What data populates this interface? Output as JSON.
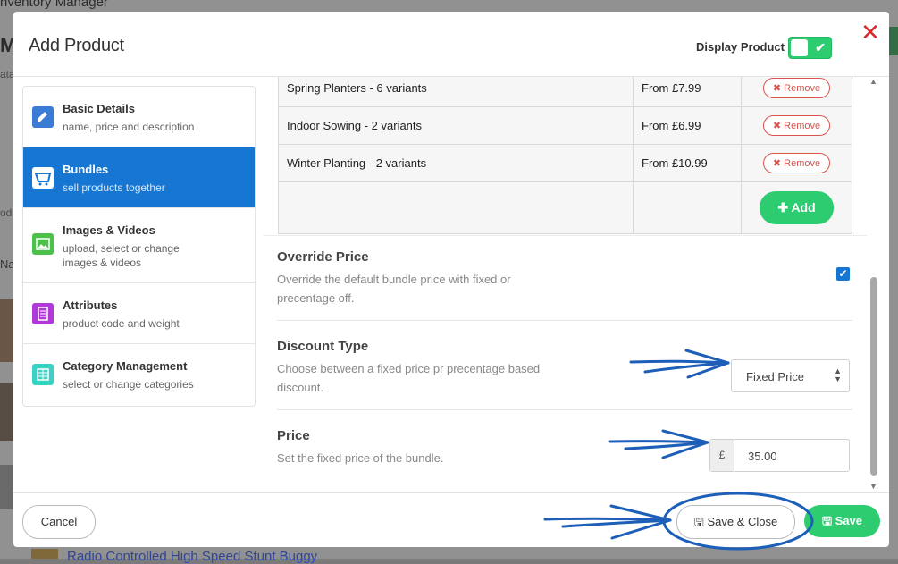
{
  "background": {
    "app_title": "nventory Manager",
    "page_initial": "M",
    "col_frag_1": "ata",
    "col_frag_2": "od",
    "col_frag_3": "Na",
    "footer_product": "Radio Controlled High Speed Stunt Buggy"
  },
  "modal": {
    "title": "Add Product",
    "display_product_label": "Display Product",
    "display_product_on": true
  },
  "sidebar": {
    "items": [
      {
        "title": "Basic Details",
        "subtitle": "name, price and description",
        "icon": "pencil-icon",
        "color": "#3a7bd5"
      },
      {
        "title": "Bundles",
        "subtitle": "sell products together",
        "icon": "basket-icon",
        "color": "#1676d2",
        "active": true
      },
      {
        "title": "Images & Videos",
        "subtitle": "upload, select or change images & videos",
        "icon": "image-icon",
        "color": "#4cc04a"
      },
      {
        "title": "Attributes",
        "subtitle": "product code and weight",
        "icon": "document-icon",
        "color": "#b03ad6"
      },
      {
        "title": "Category Management",
        "subtitle": "select or change categories",
        "icon": "grid-icon",
        "color": "#3dd1c6"
      }
    ]
  },
  "bundle_table": {
    "rows": [
      {
        "name": "Spring Planters - 6 variants",
        "price": "From £7.99",
        "action": "Remove"
      },
      {
        "name": "Indoor Sowing - 2 variants",
        "price": "From £6.99",
        "action": "Remove"
      },
      {
        "name": "Winter Planting - 2 variants",
        "price": "From £10.99",
        "action": "Remove"
      }
    ],
    "add_label": "Add"
  },
  "settings": {
    "override": {
      "title": "Override Price",
      "desc": "Override the default bundle price with fixed or precentage off.",
      "checked": true
    },
    "discount": {
      "title": "Discount Type",
      "desc": "Choose between a fixed price pr precentage based discount.",
      "value": "Fixed Price"
    },
    "price": {
      "title": "Price",
      "desc": "Set the fixed price of the bundle.",
      "currency": "£",
      "value": "35.00"
    }
  },
  "footer": {
    "cancel": "Cancel",
    "save_close": "Save & Close",
    "save": "Save"
  },
  "colors": {
    "accent": "#1676d2",
    "success": "#2ecc71",
    "danger": "#d9534f",
    "annotation": "#1d5fb8"
  }
}
